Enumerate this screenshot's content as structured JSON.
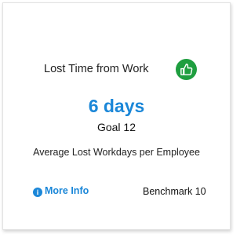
{
  "card": {
    "title": "Lost Time from Work",
    "status_icon": "thumbs-up-icon",
    "status_color": "#1e9e3f",
    "metric_value": "6 days",
    "metric_color": "#1b87d8",
    "goal_text": "Goal 12",
    "description": "Average Lost Workdays per Employee",
    "more_info_label": "More Info",
    "more_info_icon": "info-icon",
    "benchmark_text": "Benchmark 10"
  }
}
